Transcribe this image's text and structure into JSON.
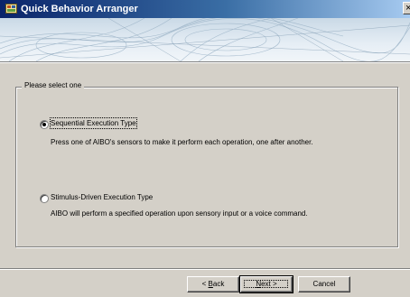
{
  "window": {
    "title": "Quick Behavior Arranger",
    "close_glyph": "×",
    "app_icon": "app-icon"
  },
  "group": {
    "label": "Please select one"
  },
  "options": [
    {
      "label": "Sequential Execution Type",
      "description": "Press one of AIBO's sensors to make it perform each operation, one after another.",
      "selected": true
    },
    {
      "label": "Stimulus-Driven Execution Type",
      "description": "AIBO will perform a specified operation upon sensory input or a voice command.",
      "selected": false
    }
  ],
  "buttons": {
    "back_prefix": "< ",
    "back_mnemonic": "B",
    "back_rest": "ack",
    "next_mnemonic": "N",
    "next_rest": "ext",
    "next_suffix": " >",
    "cancel": "Cancel"
  },
  "colors": {
    "titlebar_start": "#0a246a",
    "titlebar_end": "#a6caf0",
    "face": "#d4d0c8"
  }
}
